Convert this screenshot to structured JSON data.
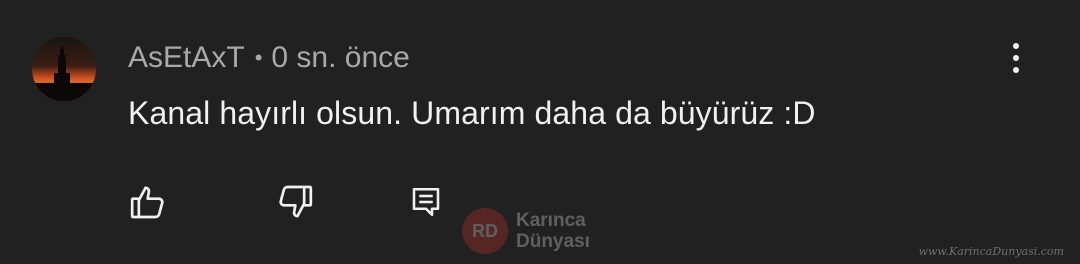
{
  "comment": {
    "author": "AsEtAxT",
    "separator": "•",
    "timestamp": "0 sn. önce",
    "text": "Kanal hayırlı olsun. Umarım daha da büyürüz :D"
  },
  "actions": {
    "like_icon": "thumb-up-outline",
    "dislike_icon": "thumb-down-outline",
    "reply_icon": "comment-reply-outline",
    "more_icon": "vertical-ellipsis"
  },
  "watermark": {
    "logo_letters": "RD",
    "logo_line1": "Karınca",
    "logo_line2": "Dünyası",
    "url": "www.KarincaDunyasi.com"
  },
  "colors": {
    "background": "#212121",
    "primary_text": "#f1f1f1",
    "secondary_text": "#a9a9a9",
    "icon": "#f1f1f1",
    "logo_red": "#e0362f"
  }
}
